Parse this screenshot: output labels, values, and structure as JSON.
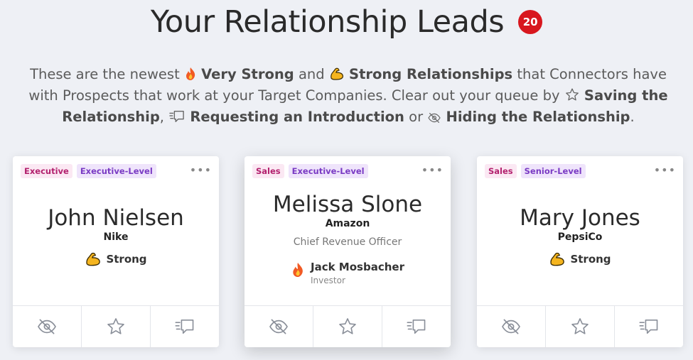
{
  "header": {
    "title": "Your Relationship Leads",
    "count": "20"
  },
  "description": {
    "t1": "These are the newest",
    "very_strong": "Very Strong",
    "t2": "and",
    "strong_rel": "Strong Relationships",
    "t3": "that Connectors have with Prospects that work at your Target Companies. Clear out your queue by",
    "saving": "Saving the Relationship",
    "t4": ",",
    "requesting": "Requesting an Introduction",
    "t5": "or",
    "hiding": "Hiding the Relationship",
    "t6": "."
  },
  "cards": [
    {
      "tags": [
        "Executive",
        "Executive-Level"
      ],
      "name": "John Nielsen",
      "company": "Nike",
      "strength": "Strong",
      "more": "•••"
    },
    {
      "tags": [
        "Sales",
        "Executive-Level"
      ],
      "name": "Melissa Slone",
      "company": "Amazon",
      "role": "Chief Revenue Officer",
      "connector": {
        "name": "Jack Mosbacher",
        "title": "Investor"
      },
      "more": "•••"
    },
    {
      "tags": [
        "Sales",
        "Senior-Level"
      ],
      "name": "Mary Jones",
      "company": "PepsiCo",
      "strength": "Strong",
      "more": "•••"
    }
  ],
  "colors": {
    "badge": "#d8171e",
    "tag_pink_text": "#b3216e",
    "tag_purple_text": "#7a3bc4",
    "fire": "#f15a24",
    "flex": "#f5b51f"
  },
  "icons": [
    "fire-icon",
    "flexed-bicep-icon",
    "star-icon",
    "request-intro-icon",
    "hide-eye-icon",
    "more-options-icon"
  ]
}
